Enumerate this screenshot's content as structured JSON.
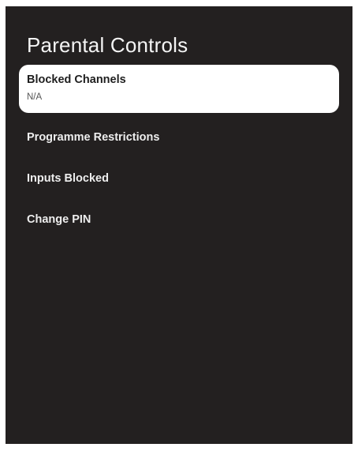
{
  "page": {
    "title": "Parental Controls"
  },
  "menu": {
    "items": [
      {
        "label": "Blocked Channels",
        "value": "N/A",
        "selected": true
      },
      {
        "label": "Programme Restrictions"
      },
      {
        "label": "Inputs Blocked"
      },
      {
        "label": "Change PIN"
      }
    ]
  },
  "colors": {
    "background": "#232020",
    "selected_bg": "#ffffff",
    "text": "#f2f2f2"
  }
}
